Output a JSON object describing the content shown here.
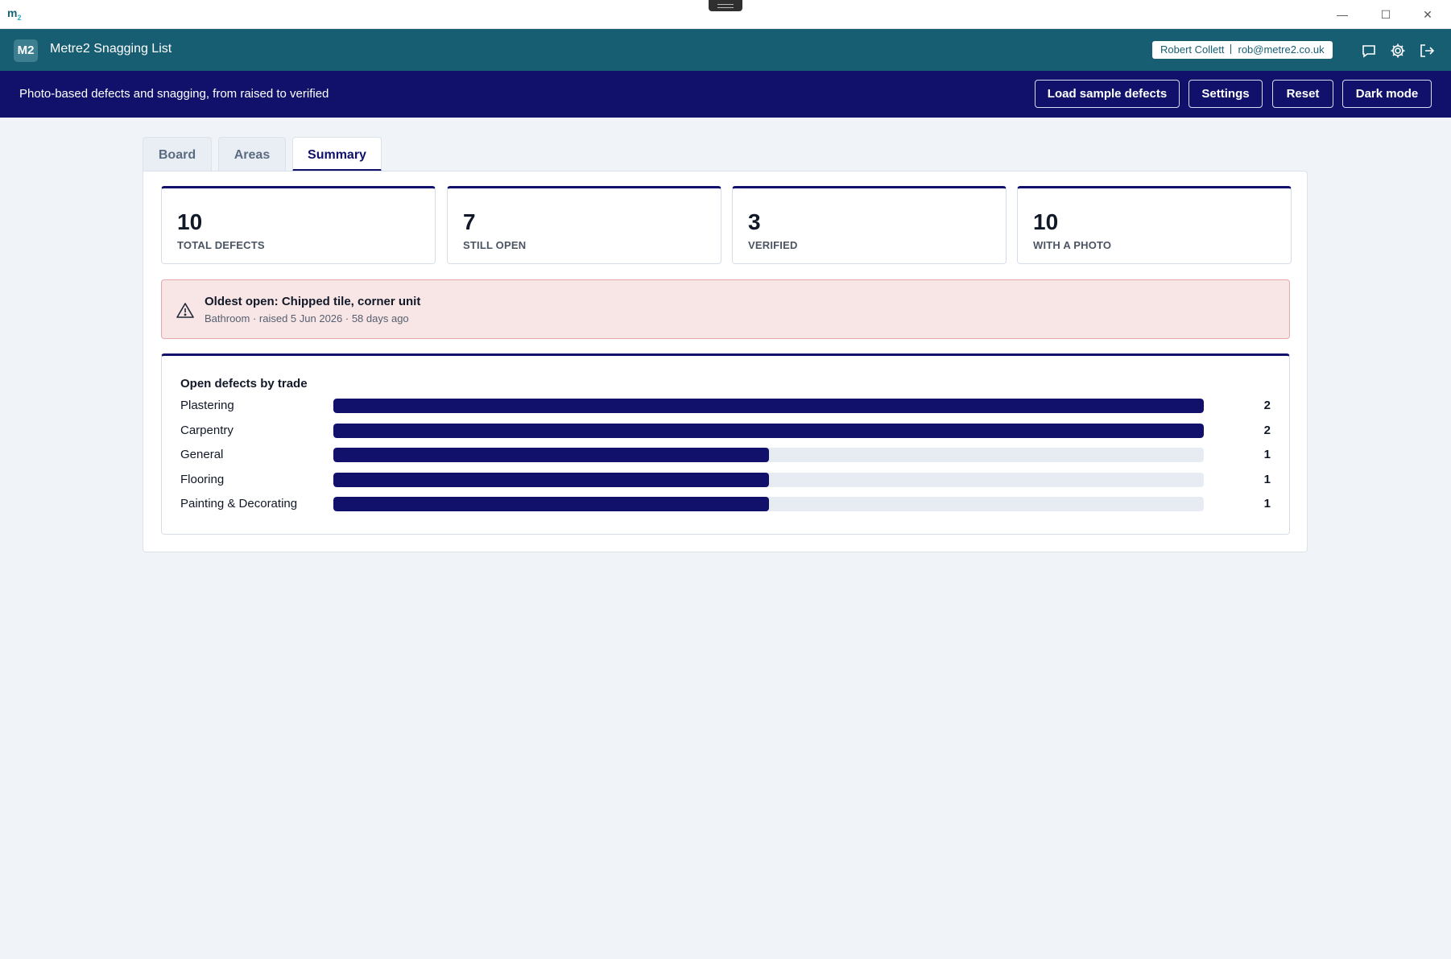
{
  "window": {
    "logo": "m",
    "logo_sub": "2",
    "minimize_glyph": "—",
    "maximize_glyph": "☐",
    "close_glyph": "✕"
  },
  "appbar": {
    "badge": "M2",
    "title": "Metre2 Snagging List",
    "user_name": "Robert Collett",
    "user_email": "rob@metre2.co.uk",
    "icons": [
      "chat-icon",
      "gear-icon",
      "logout-icon"
    ]
  },
  "subbar": {
    "tagline": "Photo-based defects and snagging, from raised to verified",
    "buttons": {
      "load_sample": "Load sample defects",
      "settings": "Settings",
      "reset": "Reset",
      "dark_mode": "Dark mode"
    }
  },
  "tabs": [
    {
      "label": "Board",
      "active": false
    },
    {
      "label": "Areas",
      "active": false
    },
    {
      "label": "Summary",
      "active": true
    }
  ],
  "stats": [
    {
      "value": "10",
      "label": "TOTAL DEFECTS"
    },
    {
      "value": "7",
      "label": "STILL OPEN"
    },
    {
      "value": "3",
      "label": "VERIFIED"
    },
    {
      "value": "10",
      "label": "WITH A PHOTO"
    }
  ],
  "alert": {
    "title": "Oldest open: Chipped tile, corner unit",
    "detail": "Bathroom · raised 5 Jun 2026 · 58 days ago",
    "icon": "warning-triangle-icon"
  },
  "chart_data": {
    "type": "bar",
    "title": "Open defects by trade",
    "categories": [
      "Plastering",
      "Carpentry",
      "General",
      "Flooring",
      "Painting & Decorating"
    ],
    "values": [
      2,
      2,
      1,
      1,
      1
    ],
    "max": 2,
    "bar_color": "#11116b",
    "track_color": "#e7ecf3"
  },
  "colors": {
    "teal": "#185e73",
    "navy": "#11116b",
    "alert_bg": "#f8e6e6",
    "alert_border": "#e4a8a8"
  }
}
